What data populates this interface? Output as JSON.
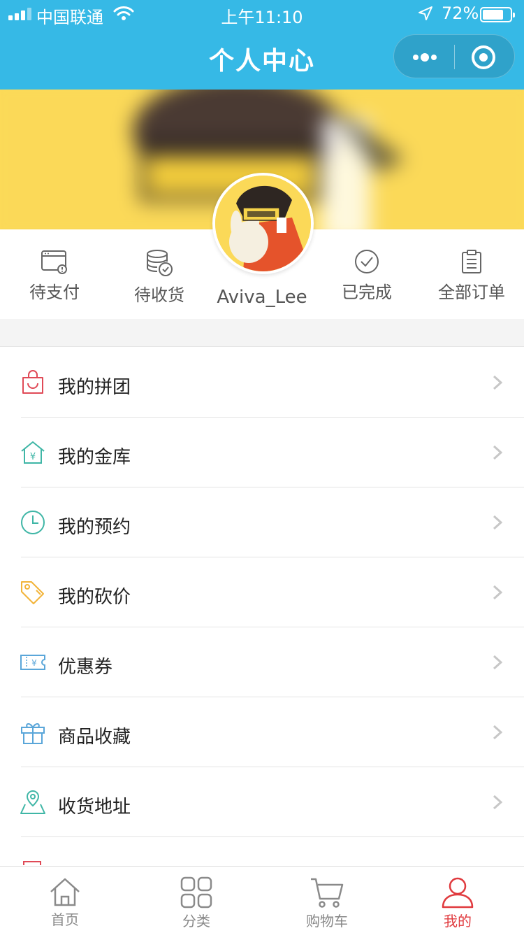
{
  "status_bar": {
    "carrier": "中国联通",
    "time": "上午11:10",
    "battery": "72%"
  },
  "nav": {
    "title": "个人中心"
  },
  "profile": {
    "username": "Aviva_Lee"
  },
  "orders": [
    {
      "label": "待支付",
      "icon": "wallet-pending-icon"
    },
    {
      "label": "待收货",
      "icon": "coins-check-icon"
    },
    {
      "label": "已完成",
      "icon": "check-circle-icon"
    },
    {
      "label": "全部订单",
      "icon": "clipboard-icon"
    }
  ],
  "menu": [
    {
      "label": "我的拼团",
      "icon": "shopping-bag-icon",
      "color": "#e04a57"
    },
    {
      "label": "我的金库",
      "icon": "vault-house-icon",
      "color": "#3fb6a6"
    },
    {
      "label": "我的预约",
      "icon": "clock-icon",
      "color": "#3fb6a6"
    },
    {
      "label": "我的砍价",
      "icon": "price-tag-icon",
      "color": "#f2b43a"
    },
    {
      "label": "优惠券",
      "icon": "coupon-icon",
      "color": "#5aa6d9"
    },
    {
      "label": "商品收藏",
      "icon": "gift-icon",
      "color": "#5aa6d9"
    },
    {
      "label": "收货地址",
      "icon": "map-pin-icon",
      "color": "#3fb6a6"
    }
  ],
  "tabs": [
    {
      "label": "首页",
      "icon": "home-icon"
    },
    {
      "label": "分类",
      "icon": "grid-icon"
    },
    {
      "label": "购物车",
      "icon": "cart-icon"
    },
    {
      "label": "我的",
      "icon": "user-icon",
      "active": true
    }
  ],
  "colors": {
    "primary": "#36b9e6",
    "banner": "#fbd958",
    "active_tab": "#e03a3e"
  }
}
